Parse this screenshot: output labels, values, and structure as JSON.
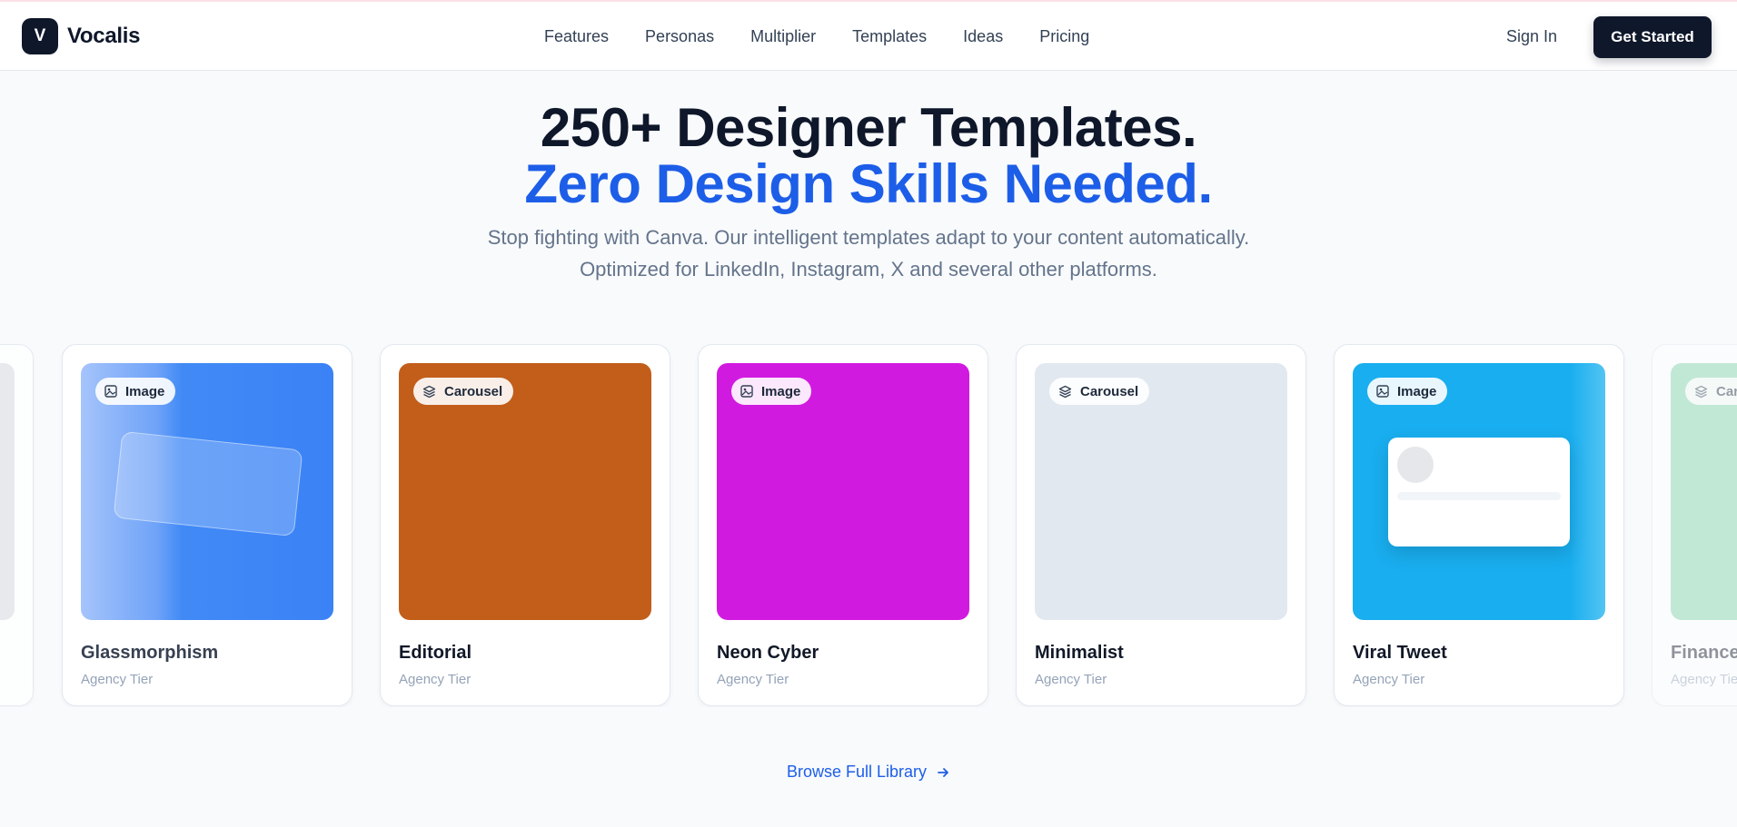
{
  "brand": {
    "mark": "V",
    "name": "Vocalis"
  },
  "nav": {
    "links": [
      "Features",
      "Personas",
      "Multiplier",
      "Templates",
      "Ideas",
      "Pricing"
    ],
    "sign_in": "Sign In",
    "get_started": "Get Started"
  },
  "hero": {
    "title_line1": "250+ Designer Templates.",
    "title_line2": "Zero Design Skills Needed.",
    "description": "Stop fighting with Canva. Our intelligent templates adapt to your content automatically. Optimized for LinkedIn, Instagram, X and several other platforms."
  },
  "templates": [
    {
      "title": "Glassmorphism",
      "tier": "Agency Tier",
      "badge": "Image",
      "badge_icon": "image-icon",
      "color": "#3b82f6"
    },
    {
      "title": "Editorial",
      "tier": "Agency Tier",
      "badge": "Carousel",
      "badge_icon": "layers-icon",
      "color": "#c25e1a"
    },
    {
      "title": "Neon Cyber",
      "tier": "Agency Tier",
      "badge": "Image",
      "badge_icon": "image-icon",
      "color": "#d11ae0"
    },
    {
      "title": "Minimalist",
      "tier": "Agency Tier",
      "badge": "Carousel",
      "badge_icon": "layers-icon",
      "color": "#e2e8f0"
    },
    {
      "title": "Viral Tweet",
      "tier": "Agency Tier",
      "badge": "Image",
      "badge_icon": "image-icon",
      "color": "#19aeef"
    },
    {
      "title": "Finance",
      "tier": "Agency Tier",
      "badge": "Carousel",
      "badge_icon": "layers-icon",
      "color": "#7fd3a8"
    }
  ],
  "browse_label": "Browse Full Library"
}
